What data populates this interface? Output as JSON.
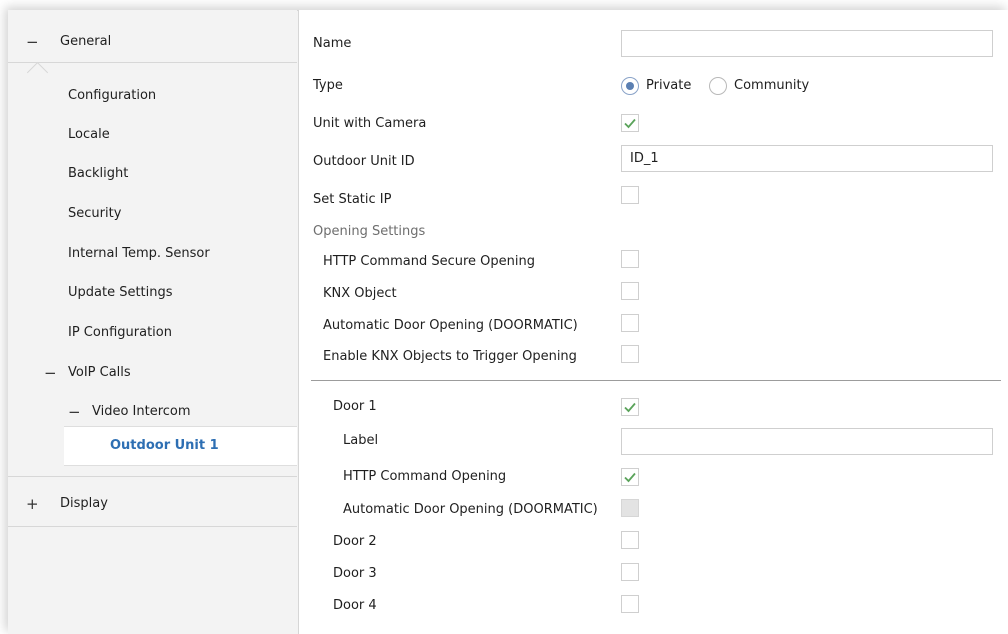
{
  "sidebar": {
    "general": "General",
    "items": [
      "Configuration",
      "Locale",
      "Backlight",
      "Security",
      "Internal Temp. Sensor",
      "Update Settings",
      "IP Configuration"
    ],
    "voip": "VoIP Calls",
    "video_intercom": "Video Intercom",
    "outdoor_unit": "Outdoor Unit 1",
    "display": "Display",
    "collapse_sign": "−",
    "expand_sign": "+"
  },
  "main": {
    "name_label": "Name",
    "name_value": "",
    "type_label": "Type",
    "type_options": [
      "Private",
      "Community"
    ],
    "type_selected": "Private",
    "camera_label": "Unit with Camera",
    "camera_checked": true,
    "unit_id_label": "Outdoor Unit ID",
    "unit_id_value": "ID_1",
    "static_ip_label": "Set Static IP",
    "static_ip_checked": false,
    "opening_section": "Opening Settings",
    "http_secure_label": "HTTP Command Secure Opening",
    "knx_object_label": "KNX Object",
    "auto_door_label": "Automatic Door Opening (DOORMATIC)",
    "enable_knx_label": "Enable KNX Objects to Trigger Opening",
    "door1": {
      "label": "Door 1",
      "checked": true,
      "label_field": "Label",
      "label_value": "",
      "http_label": "HTTP Command Opening",
      "http_checked": true,
      "auto_label": "Automatic Door Opening (DOORMATIC)",
      "auto_disabled": true
    },
    "door2": "Door 2",
    "door3": "Door 3",
    "door4": "Door 4"
  },
  "colors": {
    "accent": "#2e6fb3",
    "check": "#5aa35a",
    "radio": "#5b7fb2"
  }
}
